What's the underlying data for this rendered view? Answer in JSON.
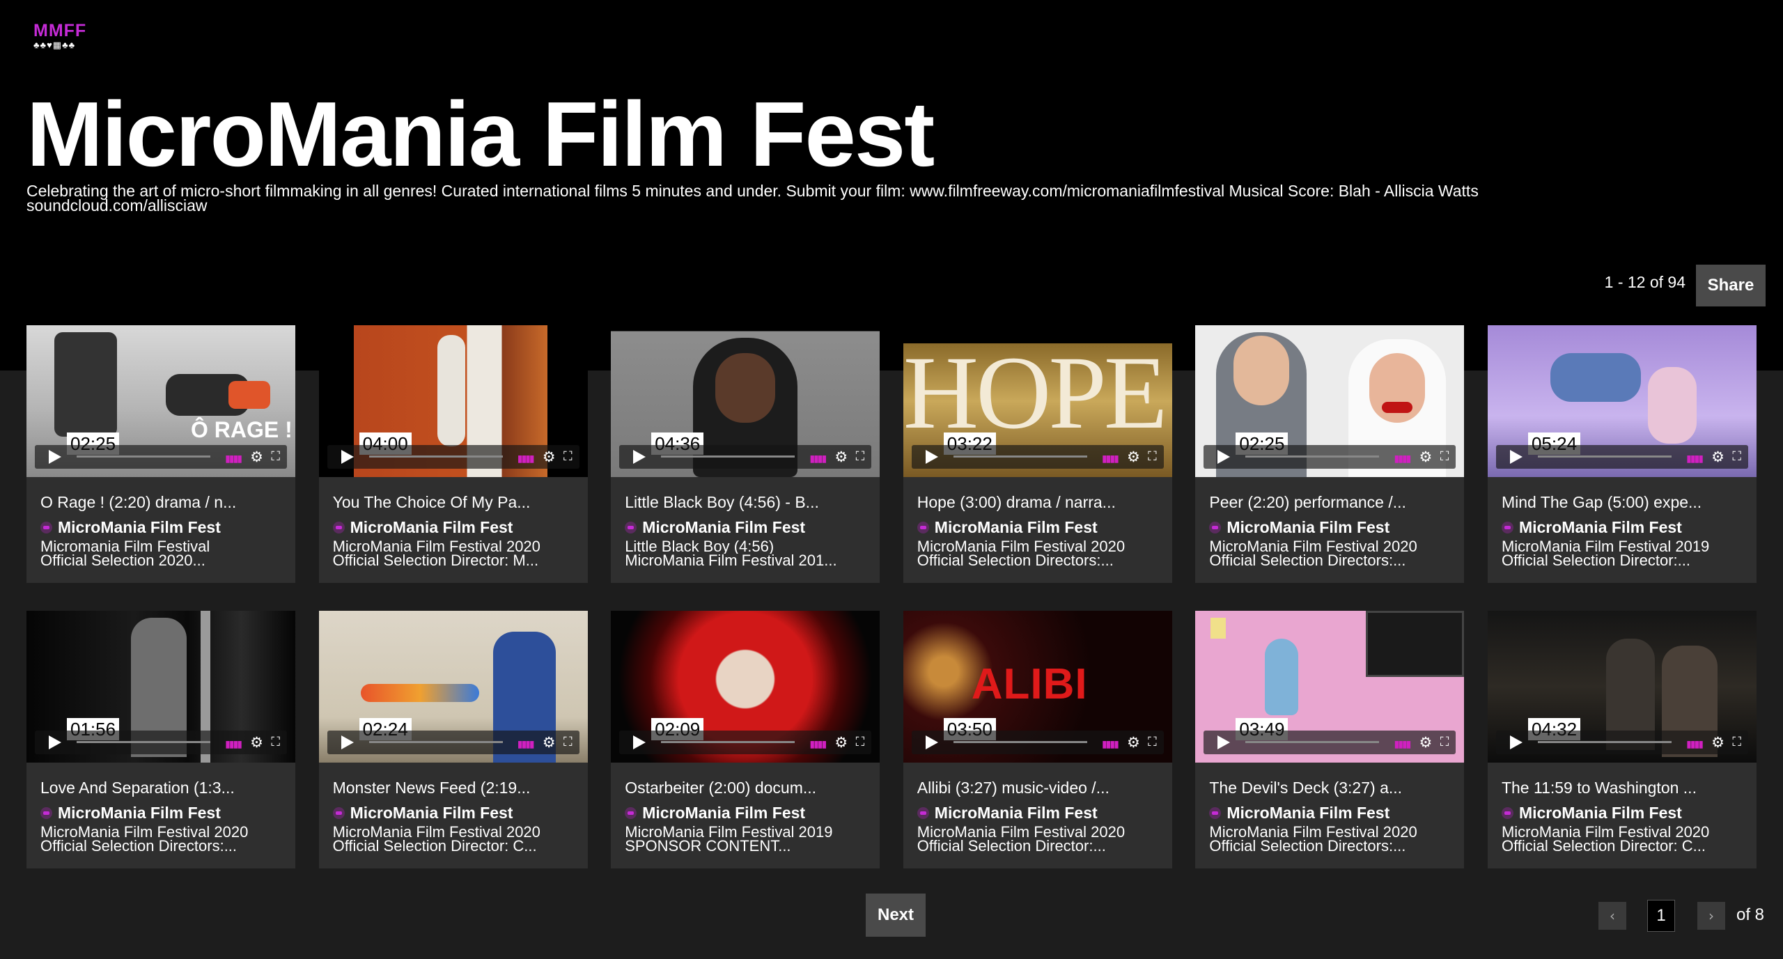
{
  "header": {
    "logo_text": "MMFF",
    "logo_glyphs": "♣♣♥▦♣♣",
    "title": "MicroMania Film Fest",
    "description": "Celebrating the art of micro-short filmmaking in all genres! Curated international films 5 minutes and under. Submit your film: www.filmfreeway.com/micromaniafilmfestival Musical Score: Blah - Alliscia Watts soundcloud.com/allisciaw"
  },
  "toolbar": {
    "range_label": "1 - 12 of 94",
    "share_label": "Share"
  },
  "videos": [
    {
      "duration": "02:25",
      "title": "O Rage ! (2:20) drama / n...",
      "channel": "MicroMania Film Fest",
      "desc1": "Micromania Film Festival",
      "desc2": "Official Selection 2020..."
    },
    {
      "duration": "04:00",
      "title": "You The Choice Of My Pa...",
      "channel": "MicroMania Film Fest",
      "desc1": "MicroMania Film Festival 2020",
      "desc2": "Official Selection Director: M..."
    },
    {
      "duration": "04:36",
      "title": "Little Black Boy (4:56) - B...",
      "channel": "MicroMania Film Fest",
      "desc1": "Little Black Boy (4:56)",
      "desc2": "MicroMania Film Festival 201..."
    },
    {
      "duration": "03:22",
      "title": "Hope (3:00) drama / narra...",
      "channel": "MicroMania Film Fest",
      "desc1": "MicroMania Film Festival 2020",
      "desc2": "Official Selection Directors:..."
    },
    {
      "duration": "02:25",
      "title": "Peer (2:20) performance /...",
      "channel": "MicroMania Film Fest",
      "desc1": "MicroMania Film Festival 2020",
      "desc2": "Official Selection Directors:..."
    },
    {
      "duration": "05:24",
      "title": "Mind The Gap (5:00) expe...",
      "channel": "MicroMania Film Fest",
      "desc1": "MicroMania Film Festival 2019",
      "desc2": "Official Selection Director:..."
    },
    {
      "duration": "01:56",
      "title": "Love And Separation (1:3...",
      "channel": "MicroMania Film Fest",
      "desc1": "MicroMania Film Festival 2020",
      "desc2": "Official Selection Directors:..."
    },
    {
      "duration": "02:24",
      "title": "Monster News Feed (2:19...",
      "channel": "MicroMania Film Fest",
      "desc1": "MicroMania Film Festival 2020",
      "desc2": "Official Selection Director: C..."
    },
    {
      "duration": "02:09",
      "title": "Ostarbeiter (2:00) docum...",
      "channel": "MicroMania Film Fest",
      "desc1": "MicroMania Film Festival 2019",
      "desc2": "SPONSOR CONTENT..."
    },
    {
      "duration": "03:50",
      "title": "Allibi (3:27) music-video /...",
      "channel": "MicroMania Film Fest",
      "desc1": "MicroMania Film Festival 2020",
      "desc2": "Official Selection Director:..."
    },
    {
      "duration": "03:49",
      "title": "The Devil's Deck (3:27) a...",
      "channel": "MicroMania Film Fest",
      "desc1": "MicroMania Film Festival 2020",
      "desc2": "Official Selection Directors:..."
    },
    {
      "duration": "04:32",
      "title": "The 11:59 to Washington ...",
      "channel": "MicroMania Film Fest",
      "desc1": "MicroMania Film Festival 2020",
      "desc2": "Official Selection Director: C..."
    }
  ],
  "thumb_text": {
    "hope": "HOPE",
    "rage": "Ô RAGE !",
    "alibi": "ALIBI"
  },
  "pagination": {
    "next_label": "Next",
    "prev_icon": "‹",
    "next_icon": "›",
    "current_page": "1",
    "of_label": "of 8"
  }
}
